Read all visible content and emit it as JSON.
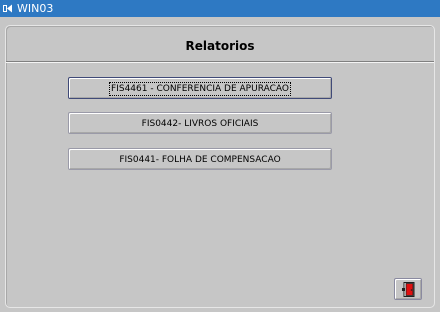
{
  "window": {
    "title": "WIN03",
    "titlebar_color": "#2e79c3"
  },
  "panel": {
    "heading": "Relatorios"
  },
  "buttons": [
    {
      "label": "FIS4461 - CONFERENCIA DE APURACAO",
      "focused": true
    },
    {
      "label": "FIS0442- LIVROS OFICIAIS",
      "focused": false
    },
    {
      "label": "FIS0441- FOLHA DE COMPENSACAO",
      "focused": false
    }
  ],
  "exit_button": {
    "icon": "exit-door-icon",
    "icon_color": "#e01010"
  }
}
